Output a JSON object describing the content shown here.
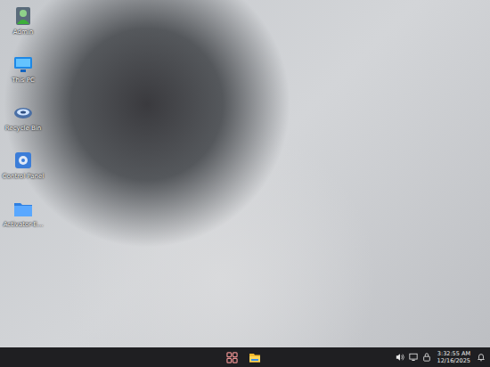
{
  "desktop": {
    "icons": [
      {
        "label": "Admin",
        "kind": "user"
      },
      {
        "label": "This PC",
        "kind": "pc"
      },
      {
        "label": "Recycle Bin",
        "kind": "recycle"
      },
      {
        "label": "Control Panel",
        "kind": "control"
      },
      {
        "label": "Activator-E...",
        "kind": "folder"
      }
    ]
  },
  "taskbar": {
    "apps": [
      {
        "kind": "start"
      },
      {
        "kind": "explorer"
      }
    ],
    "tray": [
      {
        "kind": "volume"
      },
      {
        "kind": "network"
      },
      {
        "kind": "security"
      }
    ],
    "clock": {
      "time": "3:32:55 AM",
      "date": "12/16/2025"
    },
    "notifications": {
      "kind": "bell"
    }
  }
}
